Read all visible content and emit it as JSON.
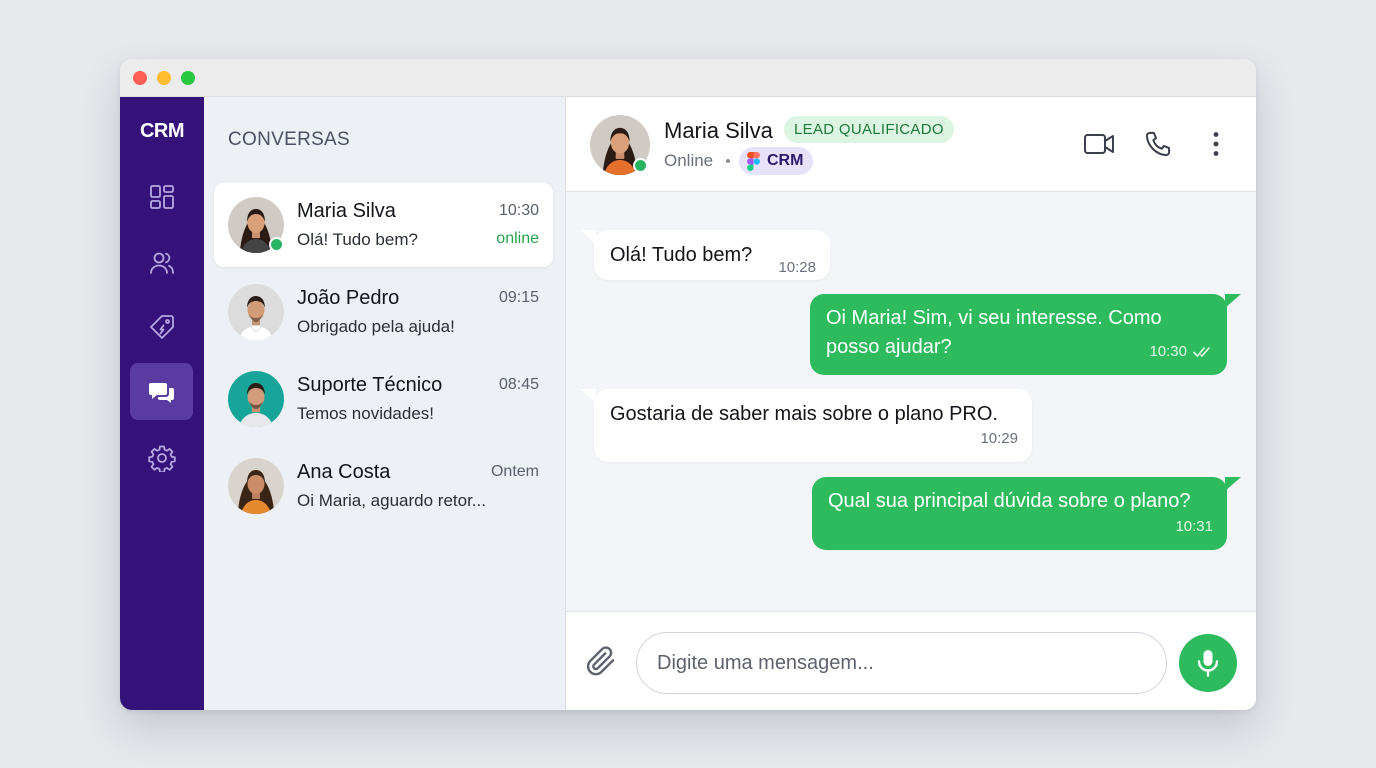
{
  "app": {
    "brand": "CRM"
  },
  "sidebar": {
    "items": [
      {
        "name": "dashboard",
        "icon": "layout-dashboard-icon"
      },
      {
        "name": "contacts",
        "icon": "users-icon"
      },
      {
        "name": "deals",
        "icon": "price-tag-icon"
      },
      {
        "name": "chat",
        "icon": "chat-bubbles-icon",
        "active": true
      },
      {
        "name": "settings",
        "icon": "gear-icon"
      }
    ]
  },
  "conversations": {
    "heading": "CONVERSAS",
    "items": [
      {
        "name": "Maria Silva",
        "preview": "Olá! Tudo bem?",
        "time": "10:30",
        "status": "online",
        "active": true
      },
      {
        "name": "João Pedro",
        "preview": "Obrigado pela ajuda!",
        "time": "09:15"
      },
      {
        "name": "Suporte Técnico",
        "preview": "Temos novidades!",
        "time": "08:45"
      },
      {
        "name": "Ana Costa",
        "preview": "Oi Maria, aguardo retor...",
        "time": "Ontem"
      }
    ]
  },
  "chat": {
    "contact": {
      "name": "Maria Silva",
      "badge": "LEAD QUALIFICADO",
      "status": "Online",
      "source_label": "CRM",
      "source_icon": "figma-logo-icon"
    },
    "actions": [
      "video-call-icon",
      "phone-icon",
      "more-vertical-icon"
    ],
    "messages": [
      {
        "direction": "in",
        "text": "Olá! Tudo bem?",
        "time": "10:28"
      },
      {
        "direction": "out",
        "text": "Oi Maria! Sim, vi seu interesse. Como posso ajudar?",
        "time": "10:30",
        "read": true
      },
      {
        "direction": "in",
        "text": "Gostaria de saber mais sobre o plano PRO.",
        "time": "10:29"
      },
      {
        "direction": "out",
        "text": "Qual sua principal dúvida sobre o plano?",
        "time": "10:31"
      }
    ],
    "composer": {
      "placeholder": "Digite uma mensagem...",
      "value": ""
    }
  },
  "colors": {
    "sidebar_bg": "#35127a",
    "sidebar_active": "#5a3ba2",
    "accent_green": "#2dbb5d",
    "badge_bg": "#dcf5e2",
    "badge_text": "#1e7a3c",
    "chip_bg": "#e7e1fa"
  }
}
